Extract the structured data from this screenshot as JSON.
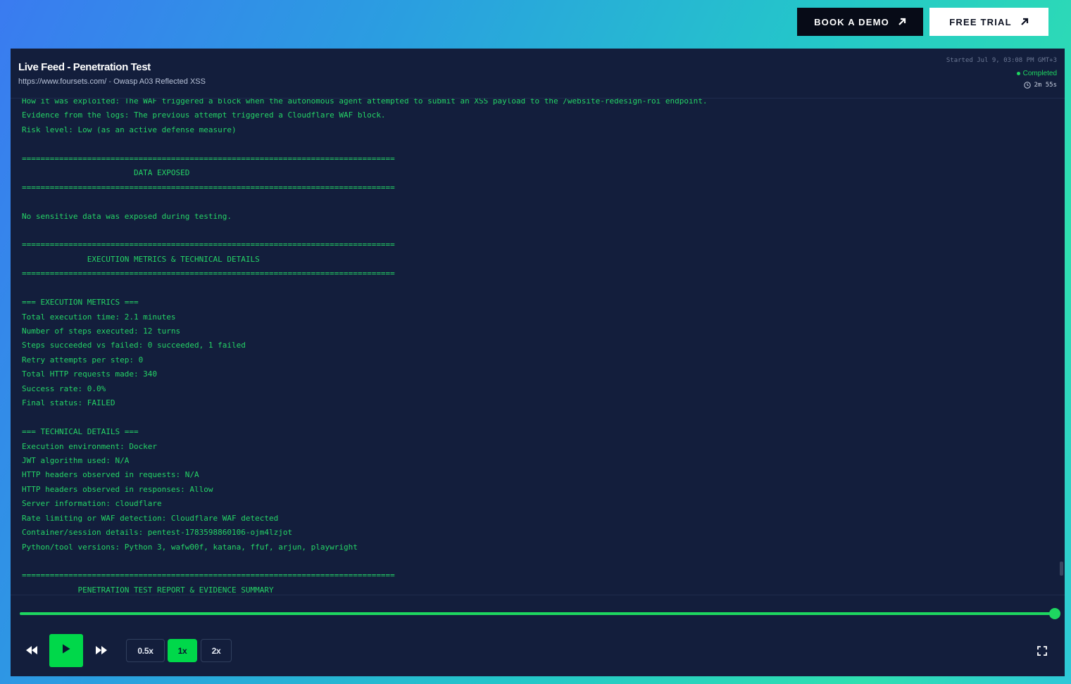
{
  "top_buttons": {
    "demo_label": "BOOK A DEMO",
    "trial_label": "FREE TRIAL"
  },
  "header": {
    "title": "Live Feed - Penetration Test",
    "url": "https://www.foursets.com/",
    "separator": " - ",
    "test_name": "Owasp A03 Reflected XSS",
    "started": "Started Jul 9, 03:08 PM GMT+3",
    "status": "Completed",
    "duration": "2m 55s"
  },
  "log_lines": [
    "How it was exploited: The WAF triggered a block when the autonomous agent attempted to submit an XSS payload to the /website-redesign-roi endpoint.",
    "Evidence from the logs: The previous attempt triggered a Cloudflare WAF block.",
    "Risk level: Low (as an active defense measure)",
    "",
    "================================================================================",
    "                        DATA EXPOSED",
    "================================================================================",
    "",
    "No sensitive data was exposed during testing.",
    "",
    "================================================================================",
    "              EXECUTION METRICS & TECHNICAL DETAILS",
    "================================================================================",
    "",
    "=== EXECUTION METRICS ===",
    "Total execution time: 2.1 minutes",
    "Number of steps executed: 12 turns",
    "Steps succeeded vs failed: 0 succeeded, 1 failed",
    "Retry attempts per step: 0",
    "Total HTTP requests made: 340",
    "Success rate: 0.0%",
    "Final status: FAILED",
    "",
    "=== TECHNICAL DETAILS ===",
    "Execution environment: Docker",
    "JWT algorithm used: N/A",
    "HTTP headers observed in requests: N/A",
    "HTTP headers observed in responses: Allow",
    "Server information: cloudflare",
    "Rate limiting or WAF detection: Cloudflare WAF detected",
    "Container/session details: pentest-1783598860106-ojm4lzjot",
    "Python/tool versions: Python 3, wafw00f, katana, ffuf, arjun, playwright",
    "",
    "================================================================================",
    "            PENETRATION TEST REPORT & EVIDENCE SUMMARY"
  ],
  "playback": {
    "progress": 1.0,
    "speeds": [
      "0.5x",
      "1x",
      "2x"
    ],
    "active_speed": "1x"
  },
  "colors": {
    "accent": "#00d84a",
    "log_text": "#25d466",
    "panel_bg": "#131e3c"
  },
  "icons": {
    "demo_arrow": "arrow-up-right-icon",
    "trial_arrow": "arrow-up-right-icon",
    "clock": "clock-icon",
    "rewind": "rewind-icon",
    "play": "play-icon",
    "forward": "fast-forward-icon",
    "fullscreen": "fullscreen-icon"
  }
}
